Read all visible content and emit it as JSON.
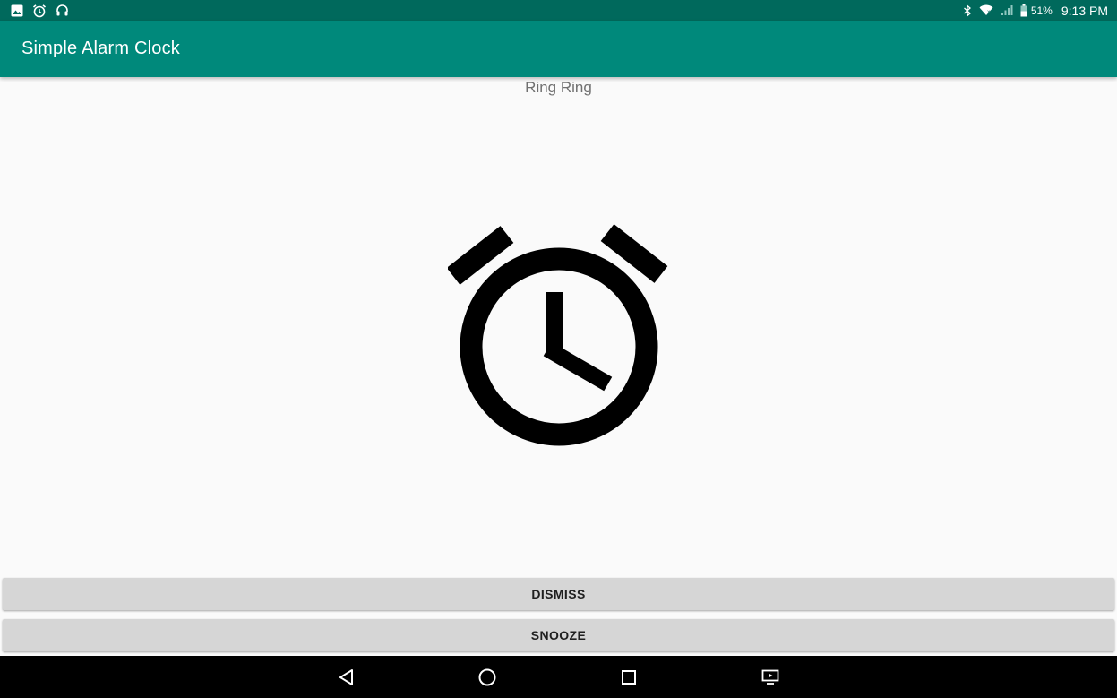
{
  "status_bar": {
    "left_icons": [
      "image-icon",
      "alarm-icon",
      "headset-icon"
    ],
    "right_icons": [
      "bluetooth-icon",
      "wifi-icon",
      "signal-icon",
      "battery-icon"
    ],
    "battery": "51%",
    "time": "9:13 PM"
  },
  "app_bar": {
    "title": "Simple Alarm Clock"
  },
  "main": {
    "alarm_label": "Ring Ring",
    "illustration": "alarm-clock-icon"
  },
  "actions": {
    "dismiss_label": "DISMISS",
    "snooze_label": "SNOOZE"
  },
  "nav_bar": {
    "buttons": [
      "back-icon",
      "home-icon",
      "recents-icon",
      "screen-cast-icon"
    ]
  },
  "colors": {
    "status_bar": "#00695c",
    "app_bar": "#00897b",
    "background": "#fafafa",
    "button": "#d6d6d6",
    "nav_bar": "#000000"
  }
}
